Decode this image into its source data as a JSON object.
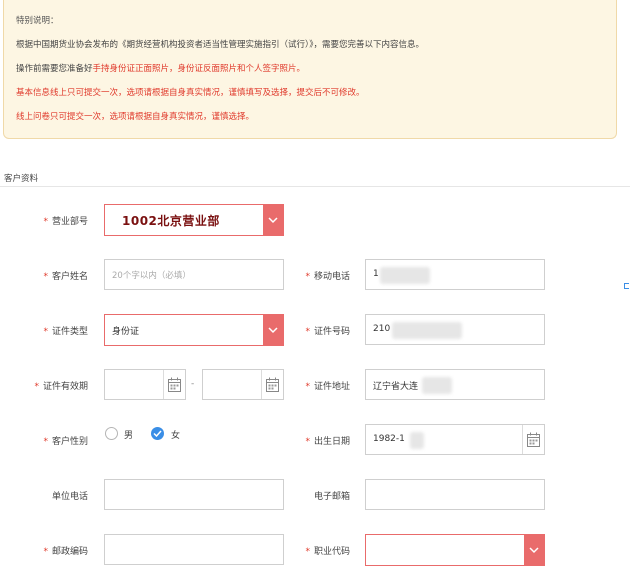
{
  "notice": {
    "title": "特别说明：",
    "line1": "根据中国期货业协会发布的《期货经营机构投资者适当性管理实施指引（试行）》，需要您完善以下内容信息。",
    "line2_prefix": "操作前需要您准备好",
    "line2_highlight": "手持身份证正面照片，身份证反面照片和个人签字照片。",
    "line3": "基本信息线上只可提交一次，选项请根据自身真实情况，谨慎填写及选择，提交后不可修改。",
    "line4": "线上问卷只可提交一次，选项请根据自身真实情况，谨慎选择。"
  },
  "section": {
    "title": "客户资料"
  },
  "form": {
    "required_mark": "*",
    "department": {
      "label": "营业部号",
      "value": "1002北京营业部"
    },
    "customer_name": {
      "label": "客户姓名",
      "placeholder": "20个字以内（必填）"
    },
    "mobile": {
      "label": "移动电话",
      "value": "1"
    },
    "id_type": {
      "label": "证件类型",
      "value": "身份证"
    },
    "id_number": {
      "label": "证件号码",
      "value": "210"
    },
    "id_validity": {
      "label": "证件有效期",
      "separator": "-"
    },
    "id_address": {
      "label": "证件地址",
      "value": "辽宁省大连"
    },
    "gender": {
      "label": "客户性别",
      "male": "男",
      "female": "女",
      "selected": "女"
    },
    "birth_date": {
      "label": "出生日期",
      "value": "1982-1"
    },
    "work_phone": {
      "label": "单位电话"
    },
    "email": {
      "label": "电子邮箱"
    },
    "postal_code": {
      "label": "邮政编码"
    },
    "job_code": {
      "label": "职业代码"
    }
  },
  "colors": {
    "accent_red": "#e96b6b",
    "warning_text": "#e03a2c",
    "radio_blue": "#3a8ee6",
    "notice_bg": "#fdf6e3"
  },
  "icons": {
    "select_caret": "chevron-down-icon",
    "date_picker": "calendar-icon",
    "radio_checked": "check-icon"
  }
}
